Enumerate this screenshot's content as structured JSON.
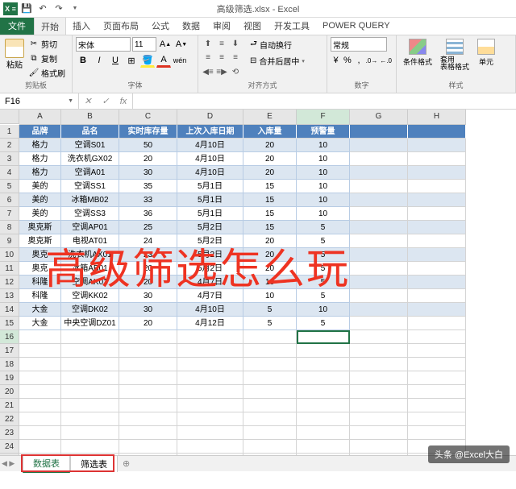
{
  "title": "高级筛选.xlsx - Excel",
  "qat": {
    "save": "💾",
    "undo": "↶",
    "redo": "↷"
  },
  "tabs": {
    "file": "文件",
    "items": [
      "开始",
      "插入",
      "页面布局",
      "公式",
      "数据",
      "审阅",
      "视图",
      "开发工具",
      "POWER QUERY"
    ],
    "active": 0
  },
  "ribbon": {
    "clipboard": {
      "label": "剪贴板",
      "paste": "粘贴",
      "cut": "剪切",
      "copy": "复制",
      "format_painter": "格式刷"
    },
    "font": {
      "label": "字体",
      "name": "宋体",
      "size": "11",
      "bold": "B",
      "italic": "I",
      "underline": "U"
    },
    "alignment": {
      "label": "对齐方式",
      "wrap": "自动换行",
      "merge": "合并后居中"
    },
    "number": {
      "label": "数字",
      "format": "常规",
      "currency": "¥",
      "percent": "%",
      "comma": ",",
      "inc": ".0",
      "dec": ".00"
    },
    "styles": {
      "label": "样式",
      "conditional": "条件格式",
      "table": "套用\n表格格式",
      "cell": "单元"
    }
  },
  "name_box": "F16",
  "formula": "",
  "columns": [
    "A",
    "B",
    "C",
    "D",
    "E",
    "F",
    "G",
    "H"
  ],
  "col_widths": [
    "cA",
    "cB",
    "cC",
    "cD",
    "cE",
    "cF",
    "cG",
    "cH",
    "cI"
  ],
  "header_row": [
    "品牌",
    "品名",
    "实时库存量",
    "上次入库日期",
    "入库量",
    "预警量"
  ],
  "data_rows": [
    [
      "格力",
      "空调S01",
      "50",
      "4月10日",
      "20",
      "10"
    ],
    [
      "格力",
      "洗衣机GX02",
      "20",
      "4月10日",
      "20",
      "10"
    ],
    [
      "格力",
      "空调A01",
      "30",
      "4月10日",
      "20",
      "10"
    ],
    [
      "美的",
      "空调SS1",
      "35",
      "5月1日",
      "15",
      "10"
    ],
    [
      "美的",
      "冰箱MB02",
      "33",
      "5月1日",
      "15",
      "10"
    ],
    [
      "美的",
      "空调SS3",
      "36",
      "5月1日",
      "15",
      "10"
    ],
    [
      "奥克斯",
      "空调AP01",
      "25",
      "5月2日",
      "15",
      "5"
    ],
    [
      "奥克斯",
      "电视AT01",
      "24",
      "5月2日",
      "20",
      "5"
    ],
    [
      "奥克",
      "洗衣机AX01",
      "23",
      "5月2日",
      "20",
      "5"
    ],
    [
      "奥克",
      "冰箱AB01",
      "20",
      "5月2日",
      "20",
      "5"
    ],
    [
      "科隆",
      "空调AK01",
      "20",
      "4月7日",
      "10",
      "5"
    ],
    [
      "科隆",
      "空调KK02",
      "30",
      "4月7日",
      "10",
      "5"
    ],
    [
      "大金",
      "空调DK02",
      "30",
      "4月10日",
      "5",
      "10"
    ],
    [
      "大金",
      "中央空调DZ01",
      "20",
      "4月12日",
      "5",
      "5"
    ]
  ],
  "overlay": "高级筛选怎么玩",
  "sheet_tabs": [
    "数据表",
    "筛选表"
  ],
  "active_sheet": 0,
  "watermark": "头条 @Excel大白",
  "active_cell": {
    "row": 16,
    "col": "F"
  }
}
